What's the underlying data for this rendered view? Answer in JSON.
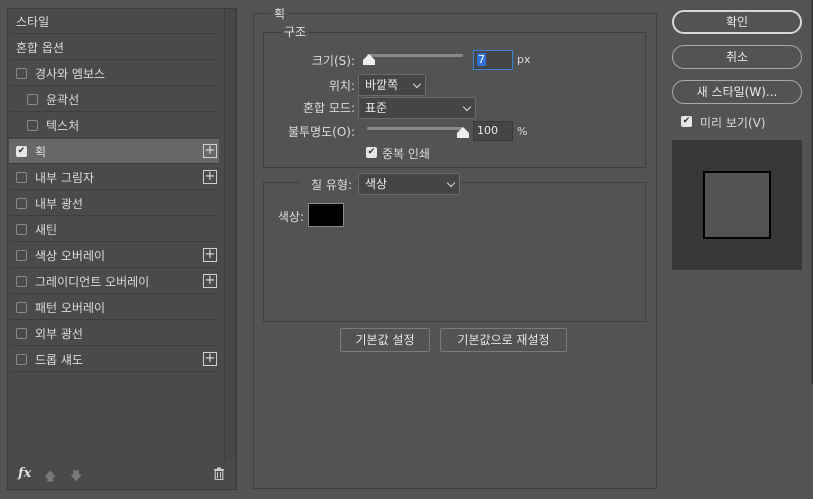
{
  "styles_list": {
    "items": [
      {
        "label": "스타일",
        "checkbox": false,
        "checked": false,
        "plus": false,
        "selected": false
      },
      {
        "label": "혼합 옵션",
        "checkbox": false,
        "checked": false,
        "plus": false,
        "selected": false
      },
      {
        "label": "경사와 엠보스",
        "checkbox": true,
        "checked": false,
        "plus": false,
        "selected": false
      },
      {
        "label": "윤곽선",
        "checkbox": true,
        "checked": false,
        "plus": false,
        "selected": false,
        "indent": true
      },
      {
        "label": "텍스처",
        "checkbox": true,
        "checked": false,
        "plus": false,
        "selected": false,
        "indent": true
      },
      {
        "label": "획",
        "checkbox": true,
        "checked": true,
        "plus": true,
        "selected": true
      },
      {
        "label": "내부 그림자",
        "checkbox": true,
        "checked": false,
        "plus": true,
        "selected": false
      },
      {
        "label": "내부 광선",
        "checkbox": true,
        "checked": false,
        "plus": false,
        "selected": false
      },
      {
        "label": "새틴",
        "checkbox": true,
        "checked": false,
        "plus": false,
        "selected": false
      },
      {
        "label": "색상 오버레이",
        "checkbox": true,
        "checked": false,
        "plus": true,
        "selected": false
      },
      {
        "label": "그레이디언트 오버레이",
        "checkbox": true,
        "checked": false,
        "plus": true,
        "selected": false
      },
      {
        "label": "패턴 오버레이",
        "checkbox": true,
        "checked": false,
        "plus": false,
        "selected": false
      },
      {
        "label": "외부 광선",
        "checkbox": true,
        "checked": false,
        "plus": false,
        "selected": false
      },
      {
        "label": "드롭 섀도",
        "checkbox": true,
        "checked": false,
        "plus": true,
        "selected": false
      }
    ],
    "footer": {
      "fx_label": "fx"
    }
  },
  "stroke": {
    "title": "획",
    "structure": {
      "title": "구조",
      "size_label": "크기(S):",
      "size_value": "7",
      "size_unit": "px",
      "size_slider": 0.02,
      "position_label": "위치:",
      "position_value": "바깥쪽",
      "blend_label": "혼합 모드:",
      "blend_value": "표준",
      "opacity_label": "불투명도(O):",
      "opacity_value": "100",
      "opacity_unit": "%",
      "opacity_slider": 1.0,
      "overprint_label": "중복 인쇄",
      "overprint_checked": true
    },
    "fill": {
      "type_label": "칠 유형:",
      "type_value": "색상",
      "color_label": "색상:",
      "color": "#000000"
    },
    "default_button": "기본값 설정",
    "reset_button": "기본값으로 재설정"
  },
  "actions": {
    "ok": "확인",
    "cancel": "취소",
    "new_style": "새 스타일(W)...",
    "preview_label": "미리 보기(V)",
    "preview_checked": true
  }
}
